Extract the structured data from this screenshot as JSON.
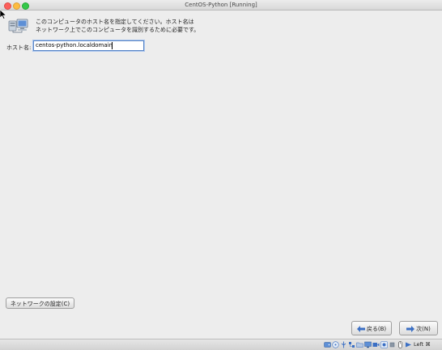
{
  "window": {
    "title": "CentOS-Python [Running]"
  },
  "intro": {
    "line1": "このコンピュータのホスト名を指定してください。ホスト名は",
    "line2": "ネットワーク上でこのコンピュータを識別するために必要です。"
  },
  "hostname": {
    "label": "ホスト名:",
    "value": "centos-python.localdomain"
  },
  "buttons": {
    "network": "ネットワークの設定(C)",
    "back": "戻る(B)",
    "next": "次(N)"
  },
  "statusbar": {
    "icons": [
      "hdd-icon",
      "optical-icon",
      "usb-icon",
      "network-icon",
      "shared-folder-icon",
      "display-icon",
      "video-capture-icon",
      "recording-icon",
      "cpu-icon",
      "mouse-icon",
      "host-key-icon"
    ],
    "host_key_label": "Left ⌘"
  },
  "colors": {
    "accent": "#3b6fc4",
    "close": "#fc605c",
    "minimize": "#fdbc40",
    "maximize": "#34c84a"
  }
}
